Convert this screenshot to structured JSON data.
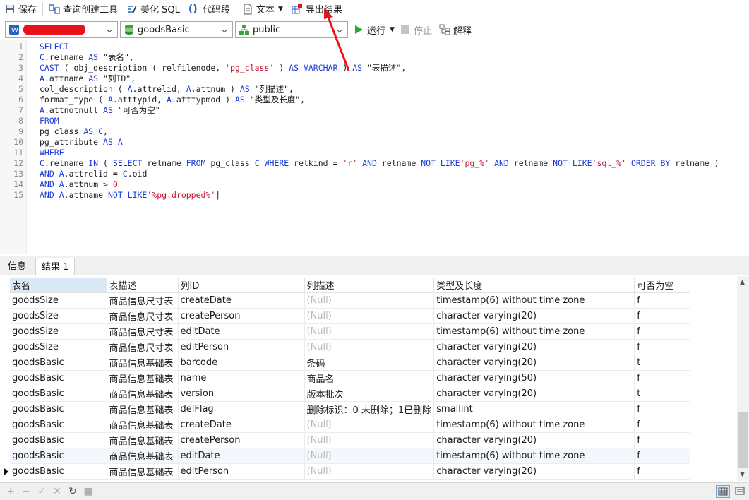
{
  "toolbar": {
    "save": "保存",
    "query_builder": "查询创建工具",
    "beautify": "美化 SQL",
    "snippet": "代码段",
    "text": "文本",
    "export": "导出结果"
  },
  "selectors": {
    "connection": "",
    "database": "goodsBasic",
    "schema": "public"
  },
  "run_controls": {
    "run": "运行",
    "stop": "停止",
    "explain": "解释"
  },
  "editor": {
    "line_numbers": [
      "1",
      "2",
      "3",
      "4",
      "5",
      "6",
      "7",
      "8",
      "9",
      "10",
      "11",
      "12",
      "13",
      "14",
      "15"
    ]
  },
  "result_tabs": {
    "info": "信息",
    "result1": "结果 1"
  },
  "grid": {
    "columns": [
      "表名",
      "表描述",
      "列ID",
      "列描述",
      "类型及长度",
      "可否为空"
    ],
    "rows": [
      [
        "goodsSize",
        "商品信息尺寸表",
        "createDate",
        "(Null)",
        "timestamp(6) without time zone",
        "f"
      ],
      [
        "goodsSize",
        "商品信息尺寸表",
        "createPerson",
        "(Null)",
        "character varying(20)",
        "f"
      ],
      [
        "goodsSize",
        "商品信息尺寸表",
        "editDate",
        "(Null)",
        "timestamp(6) without time zone",
        "f"
      ],
      [
        "goodsSize",
        "商品信息尺寸表",
        "editPerson",
        "(Null)",
        "character varying(20)",
        "f"
      ],
      [
        "goodsBasic",
        "商品信息基础表",
        "barcode",
        "条码",
        "character varying(20)",
        "t"
      ],
      [
        "goodsBasic",
        "商品信息基础表",
        "name",
        "商品名",
        "character varying(50)",
        "f"
      ],
      [
        "goodsBasic",
        "商品信息基础表",
        "version",
        "版本批次",
        "character varying(20)",
        "t"
      ],
      [
        "goodsBasic",
        "商品信息基础表",
        "delFlag",
        "删除标识：0 未删除；1已删除",
        "smallint",
        "f"
      ],
      [
        "goodsBasic",
        "商品信息基础表",
        "createDate",
        "(Null)",
        "timestamp(6) without time zone",
        "f"
      ],
      [
        "goodsBasic",
        "商品信息基础表",
        "createPerson",
        "(Null)",
        "character varying(20)",
        "f"
      ],
      [
        "goodsBasic",
        "商品信息基础表",
        "editDate",
        "(Null)",
        "timestamp(6) without time zone",
        "f"
      ],
      [
        "goodsBasic",
        "商品信息基础表",
        "editPerson",
        "(Null)",
        "character varying(20)",
        "f"
      ]
    ]
  },
  "colors": {
    "keyword": "#1c3bd6",
    "string": "#c4122f",
    "annotation_arrow": "#e8121b"
  }
}
